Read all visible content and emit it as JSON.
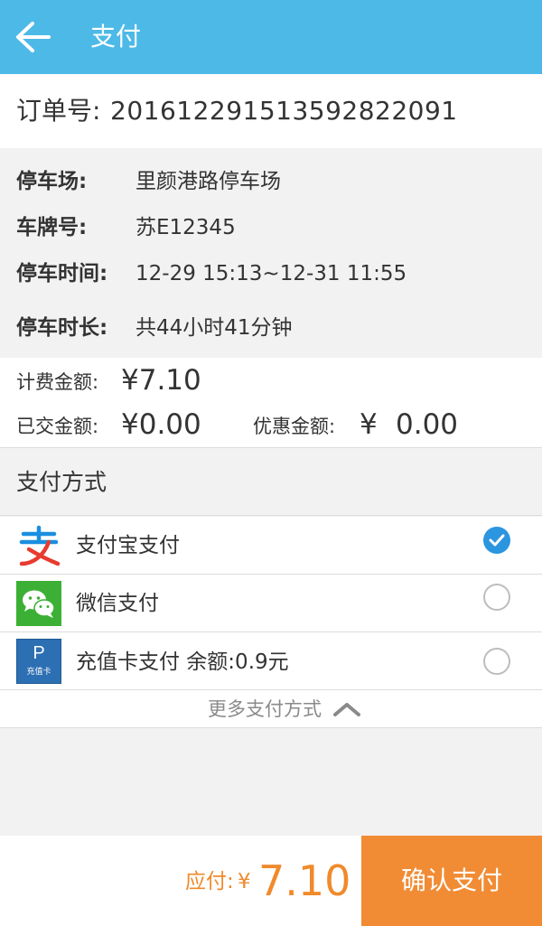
{
  "header": {
    "title": "支付",
    "back_icon": "arrow-left-icon"
  },
  "order": {
    "label": "订单号:",
    "number": "2016122915135928220​91"
  },
  "details": [
    {
      "label": "停车场:",
      "value": "里颜港路停车场"
    },
    {
      "label": "车牌号:",
      "value": "苏E12345"
    },
    {
      "label": "停车时间:",
      "value": "12-29 15:13~12-31 11:55"
    },
    {
      "label": "停车时长:",
      "value": "共44小时41分钟"
    }
  ],
  "fees": {
    "charge_label": "计费金额:",
    "charge_value": "¥7.10",
    "paid_label": "已交金额:",
    "paid_value": "¥0.00",
    "discount_label": "优惠金额:",
    "discount_yen": "¥",
    "discount_value": "0.00"
  },
  "payment": {
    "section_title": "支付方式",
    "methods": [
      {
        "label": "支付宝支付",
        "icon": "alipay-icon",
        "selected": true
      },
      {
        "label": "微信支付",
        "icon": "wechat-icon",
        "selected": false
      },
      {
        "label": "充值卡支付  余额:0.9元",
        "icon": "recharge-card-icon",
        "icon_letter": "P",
        "icon_text": "充值卡",
        "selected": false
      }
    ],
    "more_label": "更多支付方式",
    "more_icon": "chevron-up-icon"
  },
  "footer": {
    "due_label": "应付:",
    "due_yen": "¥",
    "due_amount": "7.10",
    "confirm_label": "确认支付"
  },
  "colors": {
    "header": "#4db9e7",
    "accent_orange": "#f18c34",
    "radio_checked": "#2b95e0",
    "wechat_green": "#3cb034",
    "card_blue": "#2d6fb3"
  }
}
